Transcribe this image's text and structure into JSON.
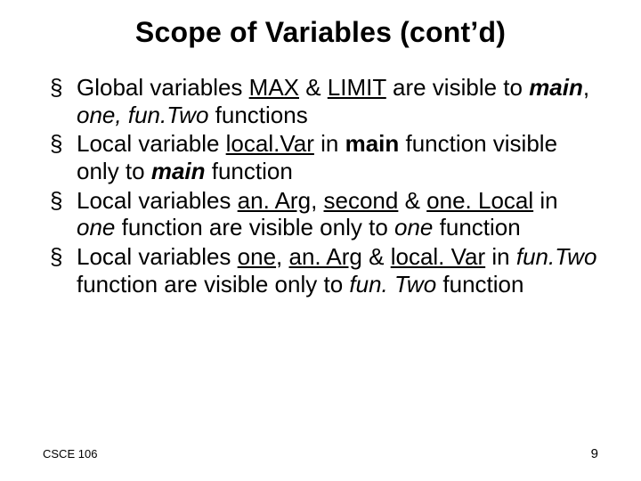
{
  "title": "Scope of Variables (cont’d)",
  "bullets": [
    {
      "parts": [
        {
          "t": "Global variables "
        },
        {
          "t": "MAX",
          "cls": "u"
        },
        {
          "t": "  & "
        },
        {
          "t": "LIMIT",
          "cls": "u"
        },
        {
          "t": " are visible to "
        },
        {
          "t": "main",
          "cls": "bi"
        },
        {
          "t": ", "
        },
        {
          "t": "one,",
          "cls": "i"
        },
        {
          "t": " "
        },
        {
          "t": "fun.Two",
          "cls": "i"
        },
        {
          "t": " functions"
        }
      ]
    },
    {
      "parts": [
        {
          "t": "Local variable "
        },
        {
          "t": "local.Var",
          "cls": "u"
        },
        {
          "t": " in "
        },
        {
          "t": "main",
          "cls": "b"
        },
        {
          "t": " function visible only to "
        },
        {
          "t": "main",
          "cls": "bi"
        },
        {
          "t": " function"
        }
      ]
    },
    {
      "parts": [
        {
          "t": "Local variables "
        },
        {
          "t": "an. Arg",
          "cls": "u"
        },
        {
          "t": ", "
        },
        {
          "t": "second",
          "cls": "u"
        },
        {
          "t": " & "
        },
        {
          "t": "one. Local",
          "cls": "u"
        },
        {
          "t": " in "
        },
        {
          "t": "one",
          "cls": "i"
        },
        {
          "t": " function are visible only to "
        },
        {
          "t": "one",
          "cls": "i"
        },
        {
          "t": " function"
        }
      ]
    },
    {
      "parts": [
        {
          "t": "Local variables "
        },
        {
          "t": "one",
          "cls": "u"
        },
        {
          "t": ", "
        },
        {
          "t": "an. Arg",
          "cls": "u"
        },
        {
          "t": " & "
        },
        {
          "t": "local. Var",
          "cls": "u"
        },
        {
          "t": " in "
        },
        {
          "t": "fun.Two",
          "cls": "i"
        },
        {
          "t": " function are visible only to "
        },
        {
          "t": "fun. Two",
          "cls": "i"
        },
        {
          "t": " function"
        }
      ]
    }
  ],
  "footer": {
    "left": "CSCE 106",
    "page": "9"
  }
}
